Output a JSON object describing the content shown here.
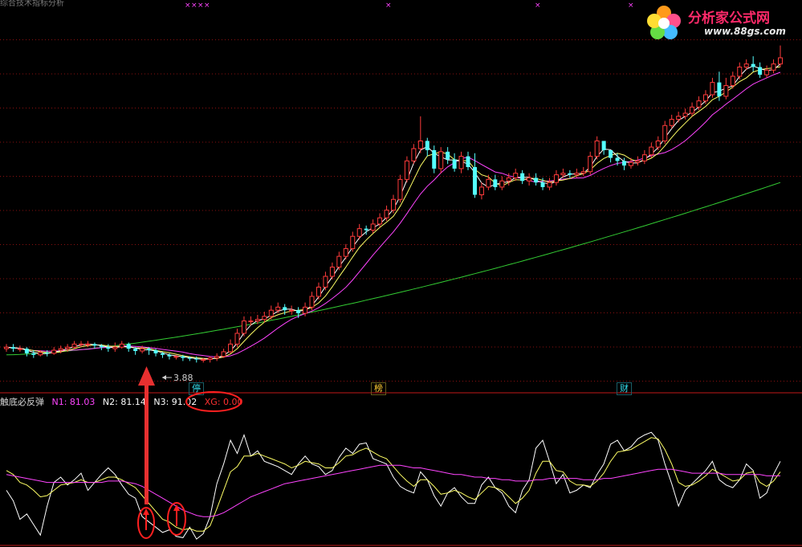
{
  "top_header": {
    "text": "综合技术指标分析"
  },
  "watermark": {
    "title": "分析家公式网",
    "url": "www.88gs.com"
  },
  "price_chart": {
    "low_label": "3.88",
    "tags": [
      {
        "label": "停",
        "color": "#33ddee"
      },
      {
        "label": "榜",
        "color": "#ffcc33"
      },
      {
        "label": "财",
        "color": "#33ddee"
      }
    ]
  },
  "indicator": {
    "name": "触底必反弹",
    "n1_label": "N1: 81.03",
    "n2_label": "N2: 81.14",
    "n3_label": "N3: 91.02",
    "xg_label": "XG: 0.00"
  },
  "colors": {
    "up": "#ff3b3b",
    "down": "#54ffff",
    "ma_short": "#ffffff",
    "ma_mid": "#ffff66",
    "ma_long": "#ff44ff",
    "ma_slow": "#33cc33",
    "grid": "#8a1010",
    "highlight": "#ff2020"
  },
  "chart_data": [
    {
      "type": "candlestick",
      "title": "",
      "n": 115,
      "open": [
        8.5,
        8.6,
        8.5,
        8.5,
        8.2,
        8.1,
        8.25,
        8.2,
        8.4,
        8.5,
        8.6,
        8.8,
        8.8,
        8.8,
        8.7,
        8.6,
        8.5,
        8.6,
        8.8,
        8.5,
        8.35,
        8.5,
        8.4,
        8.2,
        8.1,
        8.0,
        8.0,
        7.9,
        7.85,
        7.8,
        7.8,
        7.9,
        8.0,
        8.3,
        8.8,
        9.5,
        10.3,
        10.3,
        10.4,
        10.6,
        11.0,
        11.2,
        11.0,
        11.0,
        10.8,
        11.2,
        11.9,
        12.5,
        13.2,
        13.8,
        14.5,
        15.0,
        15.8,
        16.3,
        16.2,
        16.6,
        17.0,
        17.5,
        18.2,
        19.5,
        20.7,
        21.5,
        22.0,
        21.4,
        20.2,
        21.3,
        20.8,
        20.2,
        21.0,
        20.3,
        18.5,
        19.0,
        19.5,
        19.0,
        19.4,
        19.6,
        19.9,
        19.4,
        19.6,
        19.3,
        19.0,
        19.3,
        19.8,
        19.9,
        19.8,
        19.9,
        20.0,
        21.0,
        22.0,
        21.4,
        20.9,
        20.7,
        20.4,
        20.6,
        20.7,
        21.1,
        21.6,
        22.0,
        23.0,
        23.4,
        23.6,
        23.8,
        24.2,
        24.6,
        25.0,
        25.8,
        24.9,
        25.6,
        26.2,
        26.8,
        27.0,
        26.8,
        26.3,
        26.6,
        27.0
      ],
      "close": [
        8.6,
        8.5,
        8.5,
        8.2,
        8.1,
        8.25,
        8.2,
        8.4,
        8.5,
        8.6,
        8.8,
        8.8,
        8.8,
        8.7,
        8.6,
        8.5,
        8.6,
        8.8,
        8.5,
        8.35,
        8.5,
        8.4,
        8.2,
        8.1,
        8.0,
        8.0,
        7.9,
        7.85,
        7.8,
        7.8,
        7.9,
        8.0,
        8.3,
        8.8,
        9.5,
        10.3,
        10.3,
        10.4,
        10.6,
        11.0,
        11.2,
        11.0,
        11.0,
        10.8,
        11.2,
        11.9,
        12.5,
        13.2,
        13.8,
        14.5,
        15.0,
        15.8,
        16.3,
        16.2,
        16.6,
        17.0,
        17.5,
        18.2,
        19.5,
        20.7,
        21.5,
        22.0,
        21.4,
        20.2,
        21.3,
        20.8,
        20.2,
        21.0,
        20.3,
        18.5,
        19.0,
        19.5,
        19.0,
        19.4,
        19.6,
        19.9,
        19.4,
        19.6,
        19.3,
        19.0,
        19.3,
        19.8,
        19.9,
        19.8,
        19.9,
        20.0,
        21.0,
        22.0,
        21.4,
        20.9,
        20.7,
        20.4,
        20.6,
        20.7,
        21.1,
        21.6,
        22.0,
        23.0,
        23.4,
        23.6,
        23.8,
        24.2,
        24.6,
        25.0,
        25.8,
        24.9,
        25.6,
        26.2,
        26.8,
        27.0,
        26.8,
        26.3,
        26.6,
        27.0,
        27.4
      ],
      "high": [
        8.8,
        8.8,
        8.7,
        8.6,
        8.4,
        8.4,
        8.4,
        8.6,
        8.7,
        8.8,
        9.0,
        9.0,
        9.0,
        8.9,
        8.8,
        8.8,
        8.9,
        9.0,
        8.9,
        8.6,
        8.7,
        8.6,
        8.5,
        8.3,
        8.2,
        8.1,
        8.1,
        8.0,
        8.0,
        7.9,
        8.0,
        8.2,
        8.5,
        9.1,
        9.8,
        10.6,
        10.6,
        10.7,
        10.9,
        11.3,
        11.5,
        11.4,
        11.3,
        11.2,
        11.5,
        12.2,
        12.8,
        13.5,
        14.1,
        14.8,
        15.3,
        16.1,
        16.6,
        16.5,
        16.9,
        17.3,
        17.8,
        18.5,
        19.8,
        21.0,
        21.8,
        23.6,
        22.2,
        21.7,
        21.6,
        21.6,
        21.2,
        21.3,
        21.3,
        21.2,
        19.3,
        19.8,
        19.8,
        19.7,
        19.9,
        20.2,
        20.1,
        19.9,
        19.9,
        19.6,
        19.6,
        20.1,
        20.2,
        20.1,
        20.2,
        20.3,
        21.3,
        22.3,
        21.9,
        21.3,
        21.2,
        20.9,
        20.9,
        21.0,
        21.4,
        21.9,
        22.3,
        23.3,
        23.7,
        23.9,
        24.1,
        24.5,
        24.9,
        25.3,
        26.1,
        26.5,
        26.1,
        26.5,
        27.1,
        27.3,
        27.5,
        27.1,
        26.9,
        27.3,
        28.2
      ],
      "low": [
        8.3,
        8.3,
        8.3,
        8.0,
        7.9,
        8.0,
        8.0,
        8.1,
        8.2,
        8.3,
        8.5,
        8.6,
        8.6,
        8.5,
        8.4,
        8.3,
        8.3,
        8.5,
        8.3,
        8.1,
        8.2,
        8.1,
        8.0,
        7.9,
        7.8,
        7.8,
        7.7,
        7.7,
        7.6,
        7.6,
        7.6,
        7.7,
        7.9,
        8.2,
        8.6,
        9.3,
        10.0,
        10.1,
        10.2,
        10.4,
        10.8,
        10.7,
        10.7,
        10.5,
        10.6,
        11.0,
        11.7,
        12.3,
        13.0,
        13.6,
        14.3,
        14.8,
        15.6,
        15.9,
        16.0,
        16.4,
        16.8,
        17.3,
        18.0,
        19.3,
        20.5,
        21.2,
        21.0,
        19.9,
        19.9,
        20.5,
        20.0,
        19.9,
        20.1,
        18.3,
        18.2,
        18.8,
        18.8,
        18.8,
        19.1,
        19.4,
        19.2,
        19.1,
        19.1,
        18.8,
        18.8,
        19.1,
        19.6,
        19.6,
        19.6,
        19.7,
        19.8,
        20.8,
        21.1,
        20.6,
        20.4,
        20.1,
        20.2,
        20.4,
        20.5,
        20.9,
        21.4,
        21.8,
        22.8,
        23.2,
        23.4,
        23.6,
        24.0,
        24.4,
        24.8,
        24.6,
        24.7,
        25.4,
        26.0,
        26.6,
        26.5,
        26.1,
        26.1,
        26.4,
        26.8
      ]
    },
    {
      "type": "line",
      "title": "",
      "series": [
        {
          "name": "N1",
          "values": [
            40,
            32,
            18,
            22,
            14,
            6,
            28,
            46,
            50,
            44,
            48,
            53,
            40,
            46,
            52,
            57,
            52,
            44,
            37,
            34,
            20,
            16,
            12,
            8,
            10,
            5,
            4,
            12,
            3,
            7,
            20,
            45,
            60,
            78,
            68,
            82,
            66,
            70,
            62,
            60,
            58,
            55,
            52,
            60,
            66,
            60,
            58,
            52,
            55,
            65,
            72,
            68,
            75,
            76,
            64,
            62,
            60,
            50,
            43,
            40,
            38,
            54,
            48,
            36,
            28,
            38,
            42,
            35,
            30,
            30,
            44,
            50,
            42,
            38,
            28,
            23,
            40,
            48,
            72,
            78,
            62,
            45,
            52,
            38,
            40,
            44,
            42,
            52,
            60,
            75,
            78,
            70,
            73,
            79,
            82,
            84,
            78,
            60,
            45,
            28,
            40,
            45,
            50,
            55,
            62,
            48,
            44,
            42,
            48,
            60,
            55,
            34,
            38,
            52,
            62
          ]
        },
        {
          "name": "N2",
          "values": [
            55,
            52,
            46,
            44,
            40,
            35,
            36,
            40,
            44,
            45,
            46,
            48,
            46,
            46,
            48,
            50,
            50,
            48,
            45,
            42,
            36,
            30,
            24,
            18,
            16,
            12,
            10,
            11,
            9,
            9,
            13,
            26,
            40,
            54,
            58,
            66,
            66,
            68,
            66,
            64,
            62,
            60,
            57,
            59,
            62,
            61,
            60,
            57,
            57,
            61,
            66,
            67,
            70,
            72,
            69,
            66,
            64,
            58,
            52,
            47,
            43,
            48,
            48,
            43,
            37,
            38,
            40,
            38,
            35,
            33,
            38,
            43,
            42,
            40,
            35,
            30,
            34,
            40,
            53,
            62,
            62,
            55,
            54,
            47,
            44,
            44,
            43,
            47,
            53,
            62,
            69,
            70,
            71,
            74,
            77,
            80,
            79,
            71,
            60,
            46,
            43,
            44,
            47,
            51,
            56,
            53,
            50,
            47,
            48,
            53,
            54,
            46,
            43,
            47,
            54
          ]
        },
        {
          "name": "N3",
          "values": [
            52,
            51,
            50,
            49,
            48,
            47,
            46,
            46,
            46,
            46,
            46,
            46,
            46,
            46,
            46,
            47,
            47,
            47,
            46,
            45,
            43,
            40,
            37,
            34,
            31,
            28,
            25,
            23,
            21,
            20,
            20,
            21,
            23,
            26,
            29,
            32,
            35,
            37,
            39,
            41,
            43,
            45,
            46,
            47,
            48,
            49,
            50,
            51,
            52,
            53,
            54,
            55,
            56,
            57,
            58,
            59,
            59,
            59,
            59,
            58,
            57,
            57,
            56,
            55,
            54,
            53,
            52,
            52,
            51,
            50,
            50,
            49,
            49,
            48,
            48,
            47,
            47,
            47,
            48,
            48,
            49,
            49,
            49,
            49,
            49,
            48,
            48,
            48,
            49,
            49,
            50,
            51,
            52,
            53,
            54,
            55,
            56,
            56,
            56,
            55,
            54,
            53,
            53,
            53,
            53,
            53,
            52,
            52,
            52,
            52,
            52,
            52,
            51,
            51,
            51
          ]
        }
      ],
      "ylim": [
        0,
        100
      ]
    }
  ]
}
